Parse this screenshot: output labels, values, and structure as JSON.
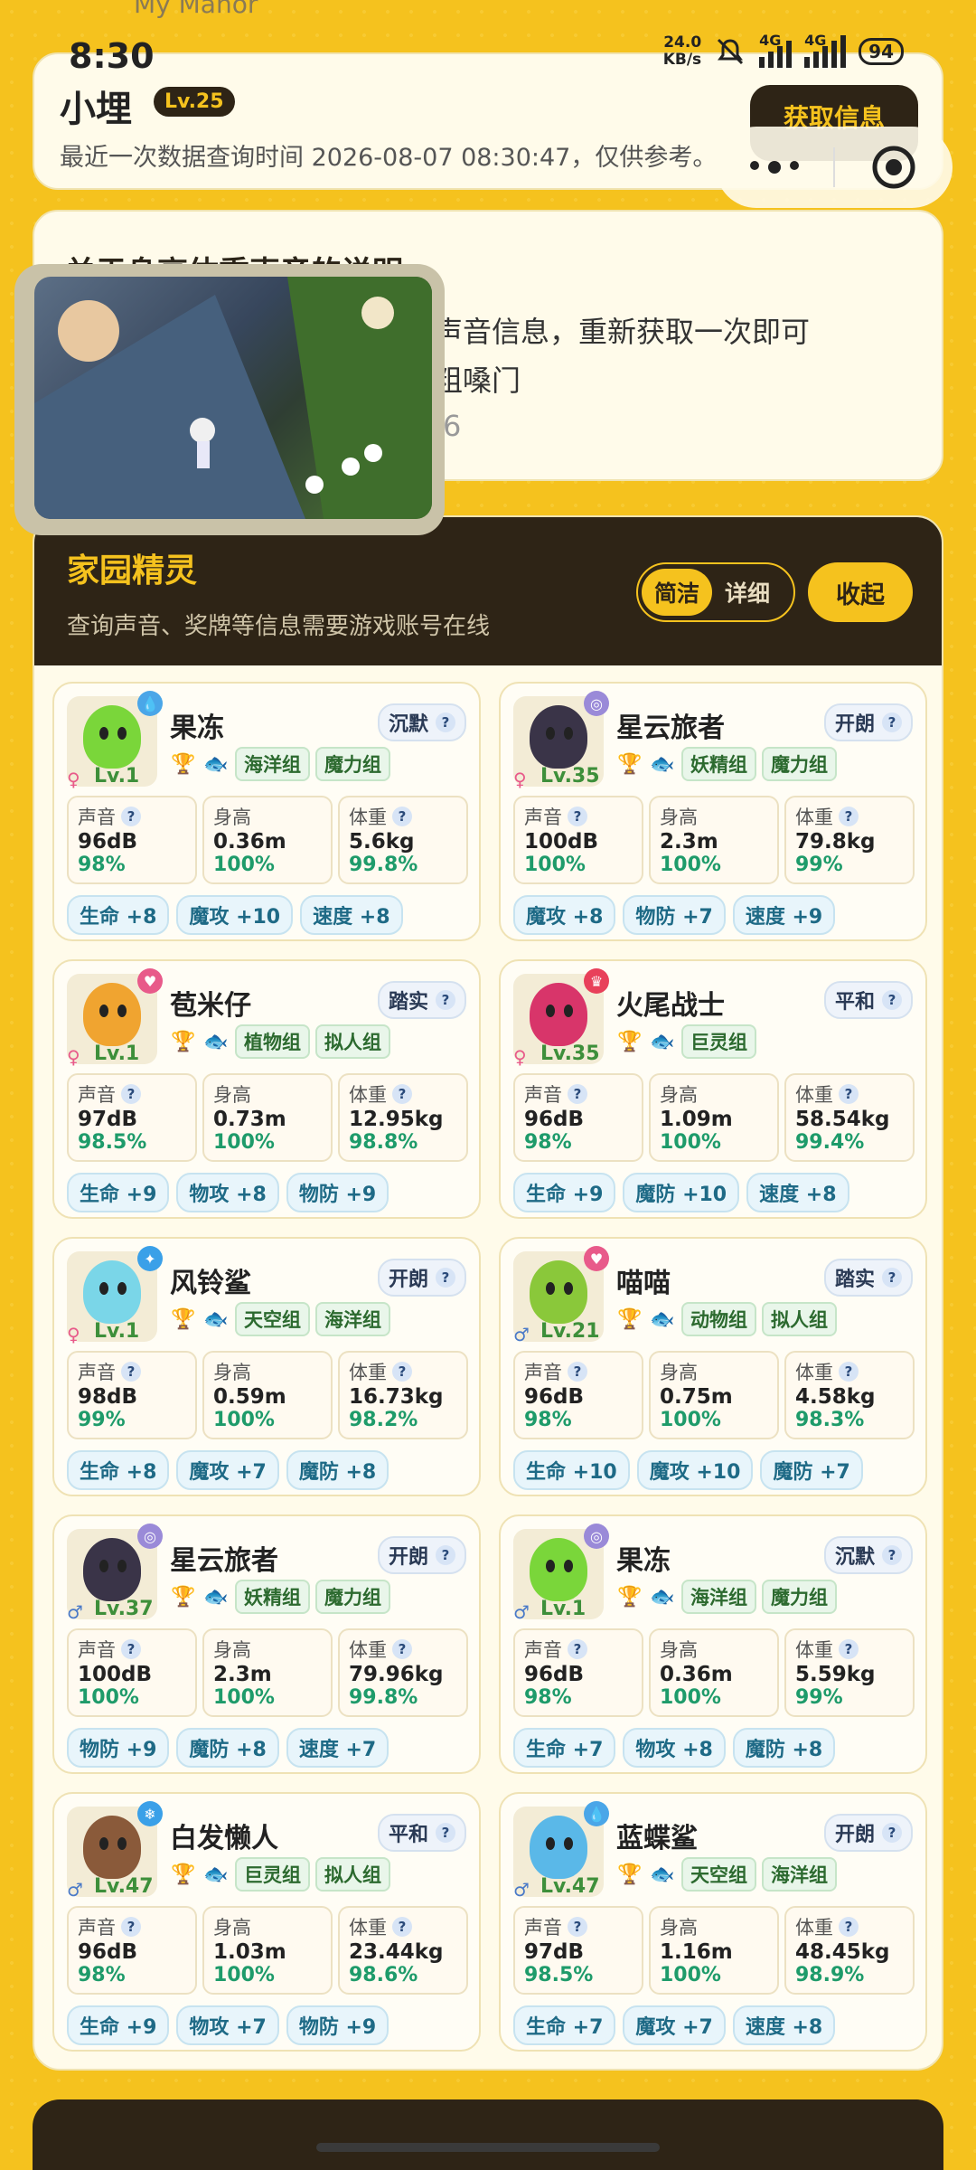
{
  "app_subtitle": "My Manor",
  "status": {
    "time": "8:30",
    "net_speed_value": "24.0",
    "net_speed_unit": "KB/s",
    "sig1": "4G",
    "sig2": "4G",
    "battery": "94"
  },
  "header": {
    "name": "小埋",
    "level": "Lv.25",
    "query_time": "最近一次数据查询时间 2026-08-07 08:30:47，仅供参考。",
    "get_info": "获取信息"
  },
  "notice": {
    "title": "关于身高体重声音的说明",
    "line1": "到声音信息，重新获取一次即可",
    "line2": "粗嗓门",
    "line3": "6"
  },
  "panel": {
    "title": "家园精灵",
    "subtitle": "查询声音、奖牌等信息需要游戏账号在线",
    "mode_simple": "简洁",
    "mode_detail": "详细",
    "collapse": "收起"
  },
  "labels": {
    "voice": "声音",
    "height": "身高",
    "weight": "体重",
    "q": "?"
  },
  "pets": [
    {
      "name": "果冻",
      "trait": "沉默",
      "gender": "♀",
      "level": "Lv.1",
      "elem_color": "#4aa6e8",
      "elem_icon": "drop-icon",
      "blob": "#7ad63a",
      "groups": [
        "海洋组",
        "魔力组"
      ],
      "voice": "96dB",
      "voice_pct": "98%",
      "height": "0.36m",
      "height_pct": "100%",
      "weight": "5.6kg",
      "weight_pct": "99.8%",
      "buffs": [
        "生命 +8",
        "魔攻 +10",
        "速度 +8"
      ]
    },
    {
      "name": "星云旅者",
      "trait": "开朗",
      "gender": "♀",
      "level": "Lv.35",
      "elem_color": "#9a8ad8",
      "elem_icon": "spiral-icon",
      "blob": "#3a3448",
      "groups": [
        "妖精组",
        "魔力组"
      ],
      "voice": "100dB",
      "voice_pct": "100%",
      "height": "2.3m",
      "height_pct": "100%",
      "weight": "79.8kg",
      "weight_pct": "99%",
      "buffs": [
        "魔攻 +8",
        "物防 +7",
        "速度 +9"
      ]
    },
    {
      "name": "苞米仔",
      "trait": "踏实",
      "gender": "♀",
      "level": "Lv.1",
      "elem_color": "#e85a8a",
      "elem_icon": "heart-icon",
      "blob": "#f0a430",
      "groups": [
        "植物组",
        "拟人组"
      ],
      "voice": "97dB",
      "voice_pct": "98.5%",
      "height": "0.73m",
      "height_pct": "100%",
      "weight": "12.95kg",
      "weight_pct": "98.8%",
      "buffs": [
        "生命 +9",
        "物攻 +8",
        "物防 +9"
      ]
    },
    {
      "name": "火尾战士",
      "trait": "平和",
      "gender": "♀",
      "level": "Lv.35",
      "elem_color": "#e8405a",
      "elem_icon": "crown-icon",
      "blob": "#d8356a",
      "groups": [
        "巨灵组"
      ],
      "voice": "96dB",
      "voice_pct": "98%",
      "height": "1.09m",
      "height_pct": "100%",
      "weight": "58.54kg",
      "weight_pct": "99.4%",
      "buffs": [
        "生命 +9",
        "魔防 +10",
        "速度 +8"
      ]
    },
    {
      "name": "风铃鲨",
      "trait": "开朗",
      "gender": "♀",
      "level": "Lv.1",
      "elem_color": "#3aa0e8",
      "elem_icon": "wind-icon",
      "blob": "#7ad6e8",
      "groups": [
        "天空组",
        "海洋组"
      ],
      "voice": "98dB",
      "voice_pct": "99%",
      "height": "0.59m",
      "height_pct": "100%",
      "weight": "16.73kg",
      "weight_pct": "98.2%",
      "buffs": [
        "生命 +8",
        "魔攻 +7",
        "魔防 +8"
      ]
    },
    {
      "name": "喵喵",
      "trait": "踏实",
      "gender": "♂",
      "level": "Lv.21",
      "elem_color": "#e85a8a",
      "elem_icon": "heart-icon",
      "blob": "#8ac83a",
      "groups": [
        "动物组",
        "拟人组"
      ],
      "voice": "96dB",
      "voice_pct": "98%",
      "height": "0.75m",
      "height_pct": "100%",
      "weight": "4.58kg",
      "weight_pct": "98.3%",
      "buffs": [
        "生命 +10",
        "魔攻 +10",
        "魔防 +7"
      ]
    },
    {
      "name": "星云旅者",
      "trait": "开朗",
      "gender": "♂",
      "level": "Lv.37",
      "elem_color": "#9a8ad8",
      "elem_icon": "spiral-icon",
      "blob": "#3a3448",
      "groups": [
        "妖精组",
        "魔力组"
      ],
      "voice": "100dB",
      "voice_pct": "100%",
      "height": "2.3m",
      "height_pct": "100%",
      "weight": "79.96kg",
      "weight_pct": "99.8%",
      "buffs": [
        "物防 +9",
        "魔防 +8",
        "速度 +7"
      ]
    },
    {
      "name": "果冻",
      "trait": "沉默",
      "gender": "♂",
      "level": "Lv.1",
      "elem_color": "#9a8ad8",
      "elem_icon": "spiral-icon",
      "blob": "#7ad63a",
      "groups": [
        "海洋组",
        "魔力组"
      ],
      "voice": "96dB",
      "voice_pct": "98%",
      "height": "0.36m",
      "height_pct": "100%",
      "weight": "5.59kg",
      "weight_pct": "99%",
      "buffs": [
        "生命 +7",
        "物攻 +8",
        "魔防 +8"
      ]
    },
    {
      "name": "白发懒人",
      "trait": "平和",
      "gender": "♂",
      "level": "Lv.47",
      "elem_color": "#3aa0e8",
      "elem_icon": "snowflake-icon",
      "blob": "#8a5a3a",
      "groups": [
        "巨灵组",
        "拟人组"
      ],
      "voice": "96dB",
      "voice_pct": "98%",
      "height": "1.03m",
      "height_pct": "100%",
      "weight": "23.44kg",
      "weight_pct": "98.6%",
      "buffs": [
        "生命 +9",
        "物攻 +7",
        "物防 +9"
      ]
    },
    {
      "name": "蓝蝶鲨",
      "trait": "开朗",
      "gender": "♂",
      "level": "Lv.47",
      "elem_color": "#4aa6e8",
      "elem_icon": "drop-icon",
      "blob": "#5ab8e8",
      "groups": [
        "天空组",
        "海洋组"
      ],
      "voice": "97dB",
      "voice_pct": "98.5%",
      "height": "1.16m",
      "height_pct": "100%",
      "weight": "48.45kg",
      "weight_pct": "98.9%",
      "buffs": [
        "生命 +7",
        "魔攻 +7",
        "速度 +8"
      ]
    }
  ]
}
